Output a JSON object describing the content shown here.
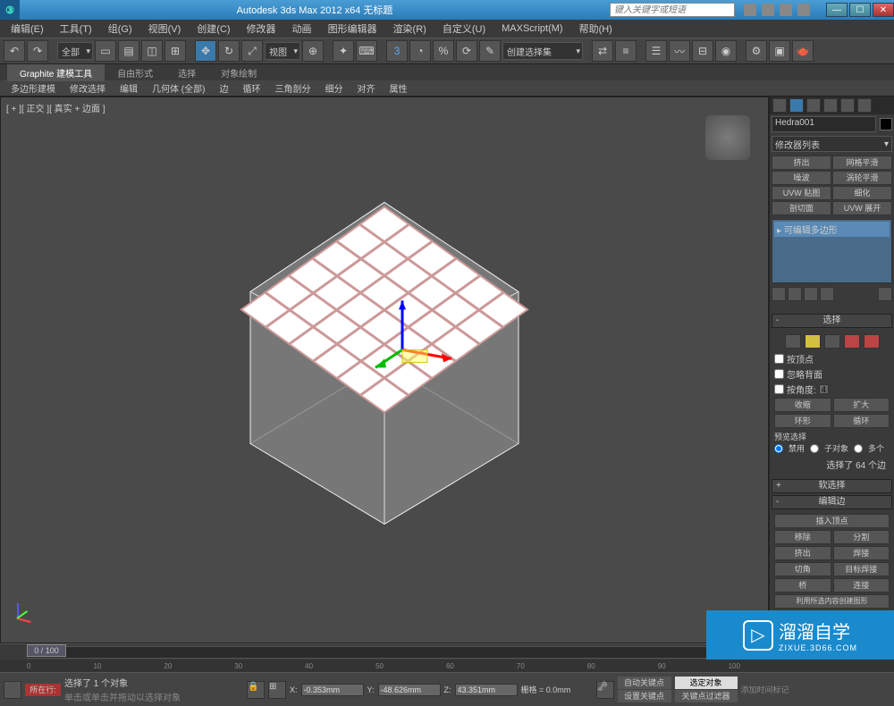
{
  "title": "Autodesk 3ds Max 2012 x64     无标题",
  "search_placeholder": "键入关键字或短语",
  "menu": [
    "编辑(E)",
    "工具(T)",
    "组(G)",
    "视图(V)",
    "创建(C)",
    "修改器",
    "动画",
    "图形编辑器",
    "渲染(R)",
    "自定义(U)",
    "MAXScript(M)",
    "帮助(H)"
  ],
  "toolbar_dropdown1": "全部",
  "toolbar_dropdown2": "视图",
  "toolbar_dropdown3": "创建选择集",
  "ribbon_tabs": [
    "Graphite 建模工具",
    "自由形式",
    "选择",
    "对象绘制"
  ],
  "ribbon2": [
    "多边形建模",
    "修改选择",
    "编辑",
    "几何体 (全部)",
    "边",
    "循环",
    "三角剖分",
    "细分",
    "对齐",
    "属性"
  ],
  "viewport_label": "[ + ][ 正交 ][ 真实 + 边面 ]",
  "object_name": "Hedra001",
  "modifier_list_label": "修改器列表",
  "mod_buttons": [
    "挤出",
    "网格平滑",
    "噪波",
    "涡轮平滑",
    "UVW 贴图",
    "细化",
    "剖切面",
    "UVW 展开"
  ],
  "mod_stack_item": "可编辑多边形",
  "rollouts": {
    "selection": "选择",
    "soft_sel": "软选择",
    "edit_edge": "编辑边",
    "by_vertex": "按顶点",
    "ignore_back": "忽略背面",
    "by_angle": "按角度:",
    "angle_val": "45.0",
    "shrink": "收缩",
    "grow": "扩大",
    "ring": "环形",
    "loop": "循环",
    "preview_sel": "预览选择",
    "preview_opts": [
      "禁用",
      "子对象",
      "多个"
    ],
    "sel_status": "选择了 64 个边",
    "insert_vertex": "插入顶点",
    "remove": "移除",
    "split": "分割",
    "extrude": "挤出",
    "weld": "焊接",
    "chamfer": "切角",
    "target_weld": "目标焊接",
    "bridge": "桥",
    "connect": "连接",
    "create_shape": "利用所选内容创建图形"
  },
  "timeline_pos": "0 / 100",
  "time_ticks": [
    "0",
    "10",
    "20",
    "30",
    "40",
    "50",
    "60",
    "70",
    "80",
    "90",
    "100"
  ],
  "status": {
    "sel_count": "选择了 1 个对象",
    "hint": "单击或单击并拖动以选择对象",
    "x": "-0.353mm",
    "y": "-48.626mm",
    "z": "43.351mm",
    "grid": "栅格 = 0.0mm",
    "auto_key": "自动关键点",
    "sel_set": "选定对象",
    "set_key": "设置关键点",
    "key_filter": "关键点过滤器",
    "add_time": "添加时间标记",
    "loc": "所在行:"
  },
  "watermark": {
    "main": "溜溜自学",
    "sub": "ZIXUE.3D66.COM"
  }
}
